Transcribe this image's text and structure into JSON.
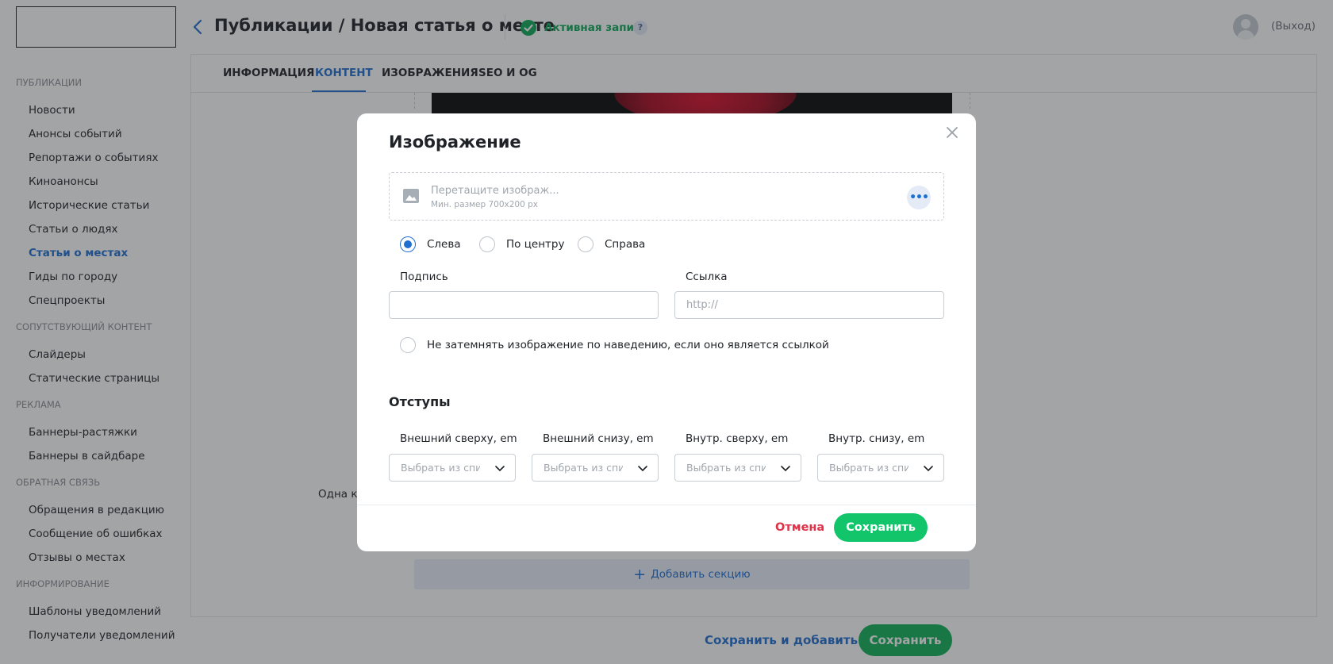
{
  "sidebar": {
    "sections": [
      {
        "title": "ПУБЛИКАЦИИ",
        "items": [
          "Новости",
          "Анонсы событий",
          "Репортажи о событиях",
          "Киноанонсы",
          "Исторические статьи",
          "Статьи о людях",
          "Статьи о местах",
          "Гиды по городу",
          "Спецпроекты"
        ]
      },
      {
        "title": "СОПУТСТВУЮЩИЙ КОНТЕНТ",
        "items": [
          "Слайдеры",
          "Статические страницы"
        ]
      },
      {
        "title": "РЕКЛАМА",
        "items": [
          "Баннеры-растяжки",
          "Баннеры в сайдбаре"
        ]
      },
      {
        "title": "ОБРАТНАЯ СВЯЗЬ",
        "items": [
          "Обращения в редакцию",
          "Сообщение об ошибках",
          "Отзывы о местах"
        ]
      },
      {
        "title": "ИНФОРМИРОВАНИЕ",
        "items": [
          "Шаблоны уведомлений",
          "Получатели уведомлений"
        ]
      }
    ],
    "active_item": "Статьи о местах"
  },
  "header": {
    "title": "Публикации / Новая статья о месте",
    "status": "Активная запись",
    "help": "?",
    "logout": "(Выход)"
  },
  "tabs": [
    "ИНФОРМАЦИЯ",
    "КОНТЕНТ",
    "ИЗОБРАЖЕНИЯ",
    "SEO И OG"
  ],
  "active_tab": "КОНТЕНТ",
  "content": {
    "side_label": "Одна ко",
    "add_section": "Добавить секцию"
  },
  "footer": {
    "save_and_add": "Сохранить и добавить",
    "save": "Сохранить"
  },
  "modal": {
    "title": "Изображение",
    "dropzone_text": "Перетащите изображ...",
    "dropzone_hint": "Мин. размер 700x200 px",
    "more": "•••",
    "align_options": [
      "Слева",
      "По центру",
      "Справа"
    ],
    "align_selected": "Слева",
    "caption_label": "Подпись",
    "caption_value": "",
    "link_label": "Ссылка",
    "link_placeholder": "http://",
    "no_dim_label": "Не затемнять изображение по наведению, если оно является ссылкой",
    "no_dim_checked": false,
    "margins_title": "Отступы",
    "margin_fields": [
      {
        "label": "Внешний сверху, em",
        "placeholder": "Выбрать из спи"
      },
      {
        "label": "Внешний снизу, em",
        "placeholder": "Выбрать из спи"
      },
      {
        "label": "Внутр. сверху, em",
        "placeholder": "Выбрать из спи"
      },
      {
        "label": "Внутр. снизу, em",
        "placeholder": "Выбрать из спи"
      }
    ],
    "cancel": "Отмена",
    "save": "Сохранить"
  },
  "colors": {
    "accent_blue": "#1f6fd0",
    "success_green": "#10b259",
    "cancel_red": "#e0334a"
  }
}
